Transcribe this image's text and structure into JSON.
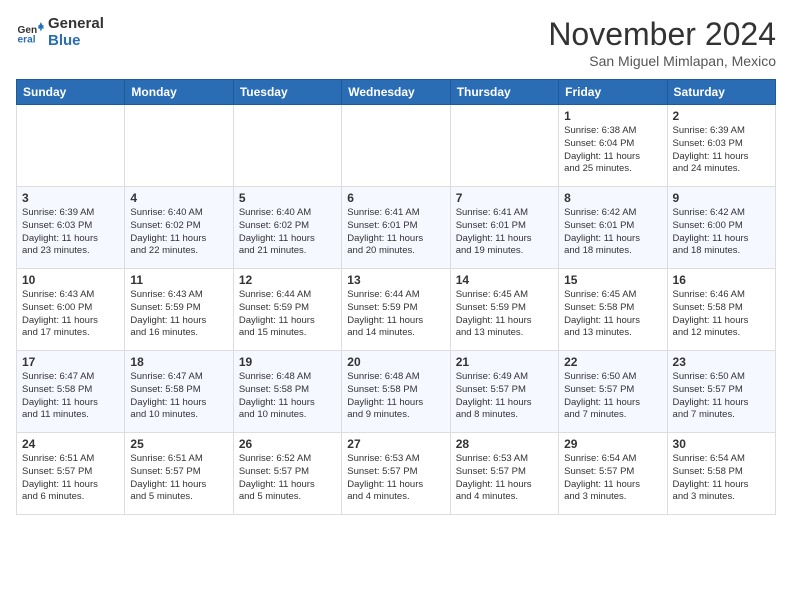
{
  "logo": {
    "general": "General",
    "blue": "Blue"
  },
  "header": {
    "month": "November 2024",
    "location": "San Miguel Mimlapan, Mexico"
  },
  "weekdays": [
    "Sunday",
    "Monday",
    "Tuesday",
    "Wednesday",
    "Thursday",
    "Friday",
    "Saturday"
  ],
  "weeks": [
    [
      {
        "day": "",
        "info": ""
      },
      {
        "day": "",
        "info": ""
      },
      {
        "day": "",
        "info": ""
      },
      {
        "day": "",
        "info": ""
      },
      {
        "day": "",
        "info": ""
      },
      {
        "day": "1",
        "info": "Sunrise: 6:38 AM\nSunset: 6:04 PM\nDaylight: 11 hours\nand 25 minutes."
      },
      {
        "day": "2",
        "info": "Sunrise: 6:39 AM\nSunset: 6:03 PM\nDaylight: 11 hours\nand 24 minutes."
      }
    ],
    [
      {
        "day": "3",
        "info": "Sunrise: 6:39 AM\nSunset: 6:03 PM\nDaylight: 11 hours\nand 23 minutes."
      },
      {
        "day": "4",
        "info": "Sunrise: 6:40 AM\nSunset: 6:02 PM\nDaylight: 11 hours\nand 22 minutes."
      },
      {
        "day": "5",
        "info": "Sunrise: 6:40 AM\nSunset: 6:02 PM\nDaylight: 11 hours\nand 21 minutes."
      },
      {
        "day": "6",
        "info": "Sunrise: 6:41 AM\nSunset: 6:01 PM\nDaylight: 11 hours\nand 20 minutes."
      },
      {
        "day": "7",
        "info": "Sunrise: 6:41 AM\nSunset: 6:01 PM\nDaylight: 11 hours\nand 19 minutes."
      },
      {
        "day": "8",
        "info": "Sunrise: 6:42 AM\nSunset: 6:01 PM\nDaylight: 11 hours\nand 18 minutes."
      },
      {
        "day": "9",
        "info": "Sunrise: 6:42 AM\nSunset: 6:00 PM\nDaylight: 11 hours\nand 18 minutes."
      }
    ],
    [
      {
        "day": "10",
        "info": "Sunrise: 6:43 AM\nSunset: 6:00 PM\nDaylight: 11 hours\nand 17 minutes."
      },
      {
        "day": "11",
        "info": "Sunrise: 6:43 AM\nSunset: 5:59 PM\nDaylight: 11 hours\nand 16 minutes."
      },
      {
        "day": "12",
        "info": "Sunrise: 6:44 AM\nSunset: 5:59 PM\nDaylight: 11 hours\nand 15 minutes."
      },
      {
        "day": "13",
        "info": "Sunrise: 6:44 AM\nSunset: 5:59 PM\nDaylight: 11 hours\nand 14 minutes."
      },
      {
        "day": "14",
        "info": "Sunrise: 6:45 AM\nSunset: 5:59 PM\nDaylight: 11 hours\nand 13 minutes."
      },
      {
        "day": "15",
        "info": "Sunrise: 6:45 AM\nSunset: 5:58 PM\nDaylight: 11 hours\nand 13 minutes."
      },
      {
        "day": "16",
        "info": "Sunrise: 6:46 AM\nSunset: 5:58 PM\nDaylight: 11 hours\nand 12 minutes."
      }
    ],
    [
      {
        "day": "17",
        "info": "Sunrise: 6:47 AM\nSunset: 5:58 PM\nDaylight: 11 hours\nand 11 minutes."
      },
      {
        "day": "18",
        "info": "Sunrise: 6:47 AM\nSunset: 5:58 PM\nDaylight: 11 hours\nand 10 minutes."
      },
      {
        "day": "19",
        "info": "Sunrise: 6:48 AM\nSunset: 5:58 PM\nDaylight: 11 hours\nand 10 minutes."
      },
      {
        "day": "20",
        "info": "Sunrise: 6:48 AM\nSunset: 5:58 PM\nDaylight: 11 hours\nand 9 minutes."
      },
      {
        "day": "21",
        "info": "Sunrise: 6:49 AM\nSunset: 5:57 PM\nDaylight: 11 hours\nand 8 minutes."
      },
      {
        "day": "22",
        "info": "Sunrise: 6:50 AM\nSunset: 5:57 PM\nDaylight: 11 hours\nand 7 minutes."
      },
      {
        "day": "23",
        "info": "Sunrise: 6:50 AM\nSunset: 5:57 PM\nDaylight: 11 hours\nand 7 minutes."
      }
    ],
    [
      {
        "day": "24",
        "info": "Sunrise: 6:51 AM\nSunset: 5:57 PM\nDaylight: 11 hours\nand 6 minutes."
      },
      {
        "day": "25",
        "info": "Sunrise: 6:51 AM\nSunset: 5:57 PM\nDaylight: 11 hours\nand 5 minutes."
      },
      {
        "day": "26",
        "info": "Sunrise: 6:52 AM\nSunset: 5:57 PM\nDaylight: 11 hours\nand 5 minutes."
      },
      {
        "day": "27",
        "info": "Sunrise: 6:53 AM\nSunset: 5:57 PM\nDaylight: 11 hours\nand 4 minutes."
      },
      {
        "day": "28",
        "info": "Sunrise: 6:53 AM\nSunset: 5:57 PM\nDaylight: 11 hours\nand 4 minutes."
      },
      {
        "day": "29",
        "info": "Sunrise: 6:54 AM\nSunset: 5:57 PM\nDaylight: 11 hours\nand 3 minutes."
      },
      {
        "day": "30",
        "info": "Sunrise: 6:54 AM\nSunset: 5:58 PM\nDaylight: 11 hours\nand 3 minutes."
      }
    ]
  ]
}
